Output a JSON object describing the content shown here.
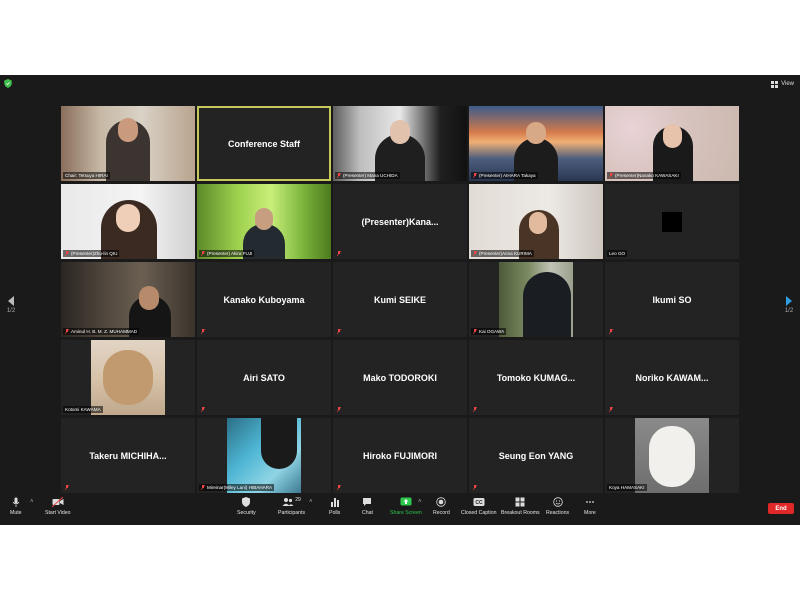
{
  "view_label": "View",
  "pager": {
    "left": "1/2",
    "right": "1/2"
  },
  "tiles": {
    "t0": {
      "label": "Chair: Tetsuya HIRAI"
    },
    "t1": {
      "name": "Conference Staff"
    },
    "t2": {
      "label": "(Presenter) Mana UCHIDA"
    },
    "t3": {
      "label": "(Presenter) AIHARA Takaya"
    },
    "t4": {
      "label": "(Presenter)Nanako KAWASAKI"
    },
    "t5": {
      "label": "(Presenter)Zhu-lin QIU"
    },
    "t6": {
      "label": "(Presenter) Akira FUJI"
    },
    "t7": {
      "name": "(Presenter)Kana..."
    },
    "t8": {
      "label": "(Presenter)Anna KURIMA"
    },
    "t9": {
      "label": "Leo GO"
    },
    "t10": {
      "label": "Aminul H. B. M. Z. MUHAMMAD"
    },
    "t11": {
      "name": "Kanako Kuboyama"
    },
    "t12": {
      "name": "Kumi SEIKE"
    },
    "t13": {
      "label": "Kai OGAWA"
    },
    "t14": {
      "name": "Ikumi SO"
    },
    "t15": {
      "label": "Kotomi KAWAMA"
    },
    "t16": {
      "name": "Airi SATO"
    },
    "t17": {
      "name": "Mako TODOROKI"
    },
    "t18": {
      "name": "Tomoko  KUMAG..."
    },
    "t19": {
      "name": "Noriko  KAWAM..."
    },
    "t20": {
      "name": "Takeru  MICHIHA..."
    },
    "t21": {
      "label": "Mireinar(Miley Lani) HIBAHARA"
    },
    "t22": {
      "name": "Hiroko FUJIMORI"
    },
    "t23": {
      "name": "Seung Eon YANG"
    },
    "t24": {
      "label": "Koya HAMASAKI"
    }
  },
  "toolbar": {
    "mute": "Mute",
    "start_video": "Start Video",
    "security": "Security",
    "participants": "Participants",
    "participants_count": "29",
    "polls": "Polls",
    "chat": "Chat",
    "share_screen": "Share Screen",
    "record": "Record",
    "closed_caption": "Closed Caption",
    "breakout_rooms": "Breakout Rooms",
    "reactions": "Reactions",
    "more": "More",
    "end": "End"
  },
  "colors": {
    "share_green": "#2dc84d",
    "end_red": "#e02828",
    "active_border": "#c4c95a",
    "security_green": "#3fbf4f"
  },
  "icons": [
    "shield-icon",
    "grid-view-icon",
    "microphone-icon",
    "video-camera-icon",
    "participants-icon",
    "polls-icon",
    "chat-icon",
    "share-screen-icon",
    "record-icon",
    "closed-caption-icon",
    "breakout-rooms-icon",
    "reactions-icon",
    "more-icon",
    "muted-mic-icon",
    "chevron-left-icon",
    "chevron-right-icon"
  ]
}
